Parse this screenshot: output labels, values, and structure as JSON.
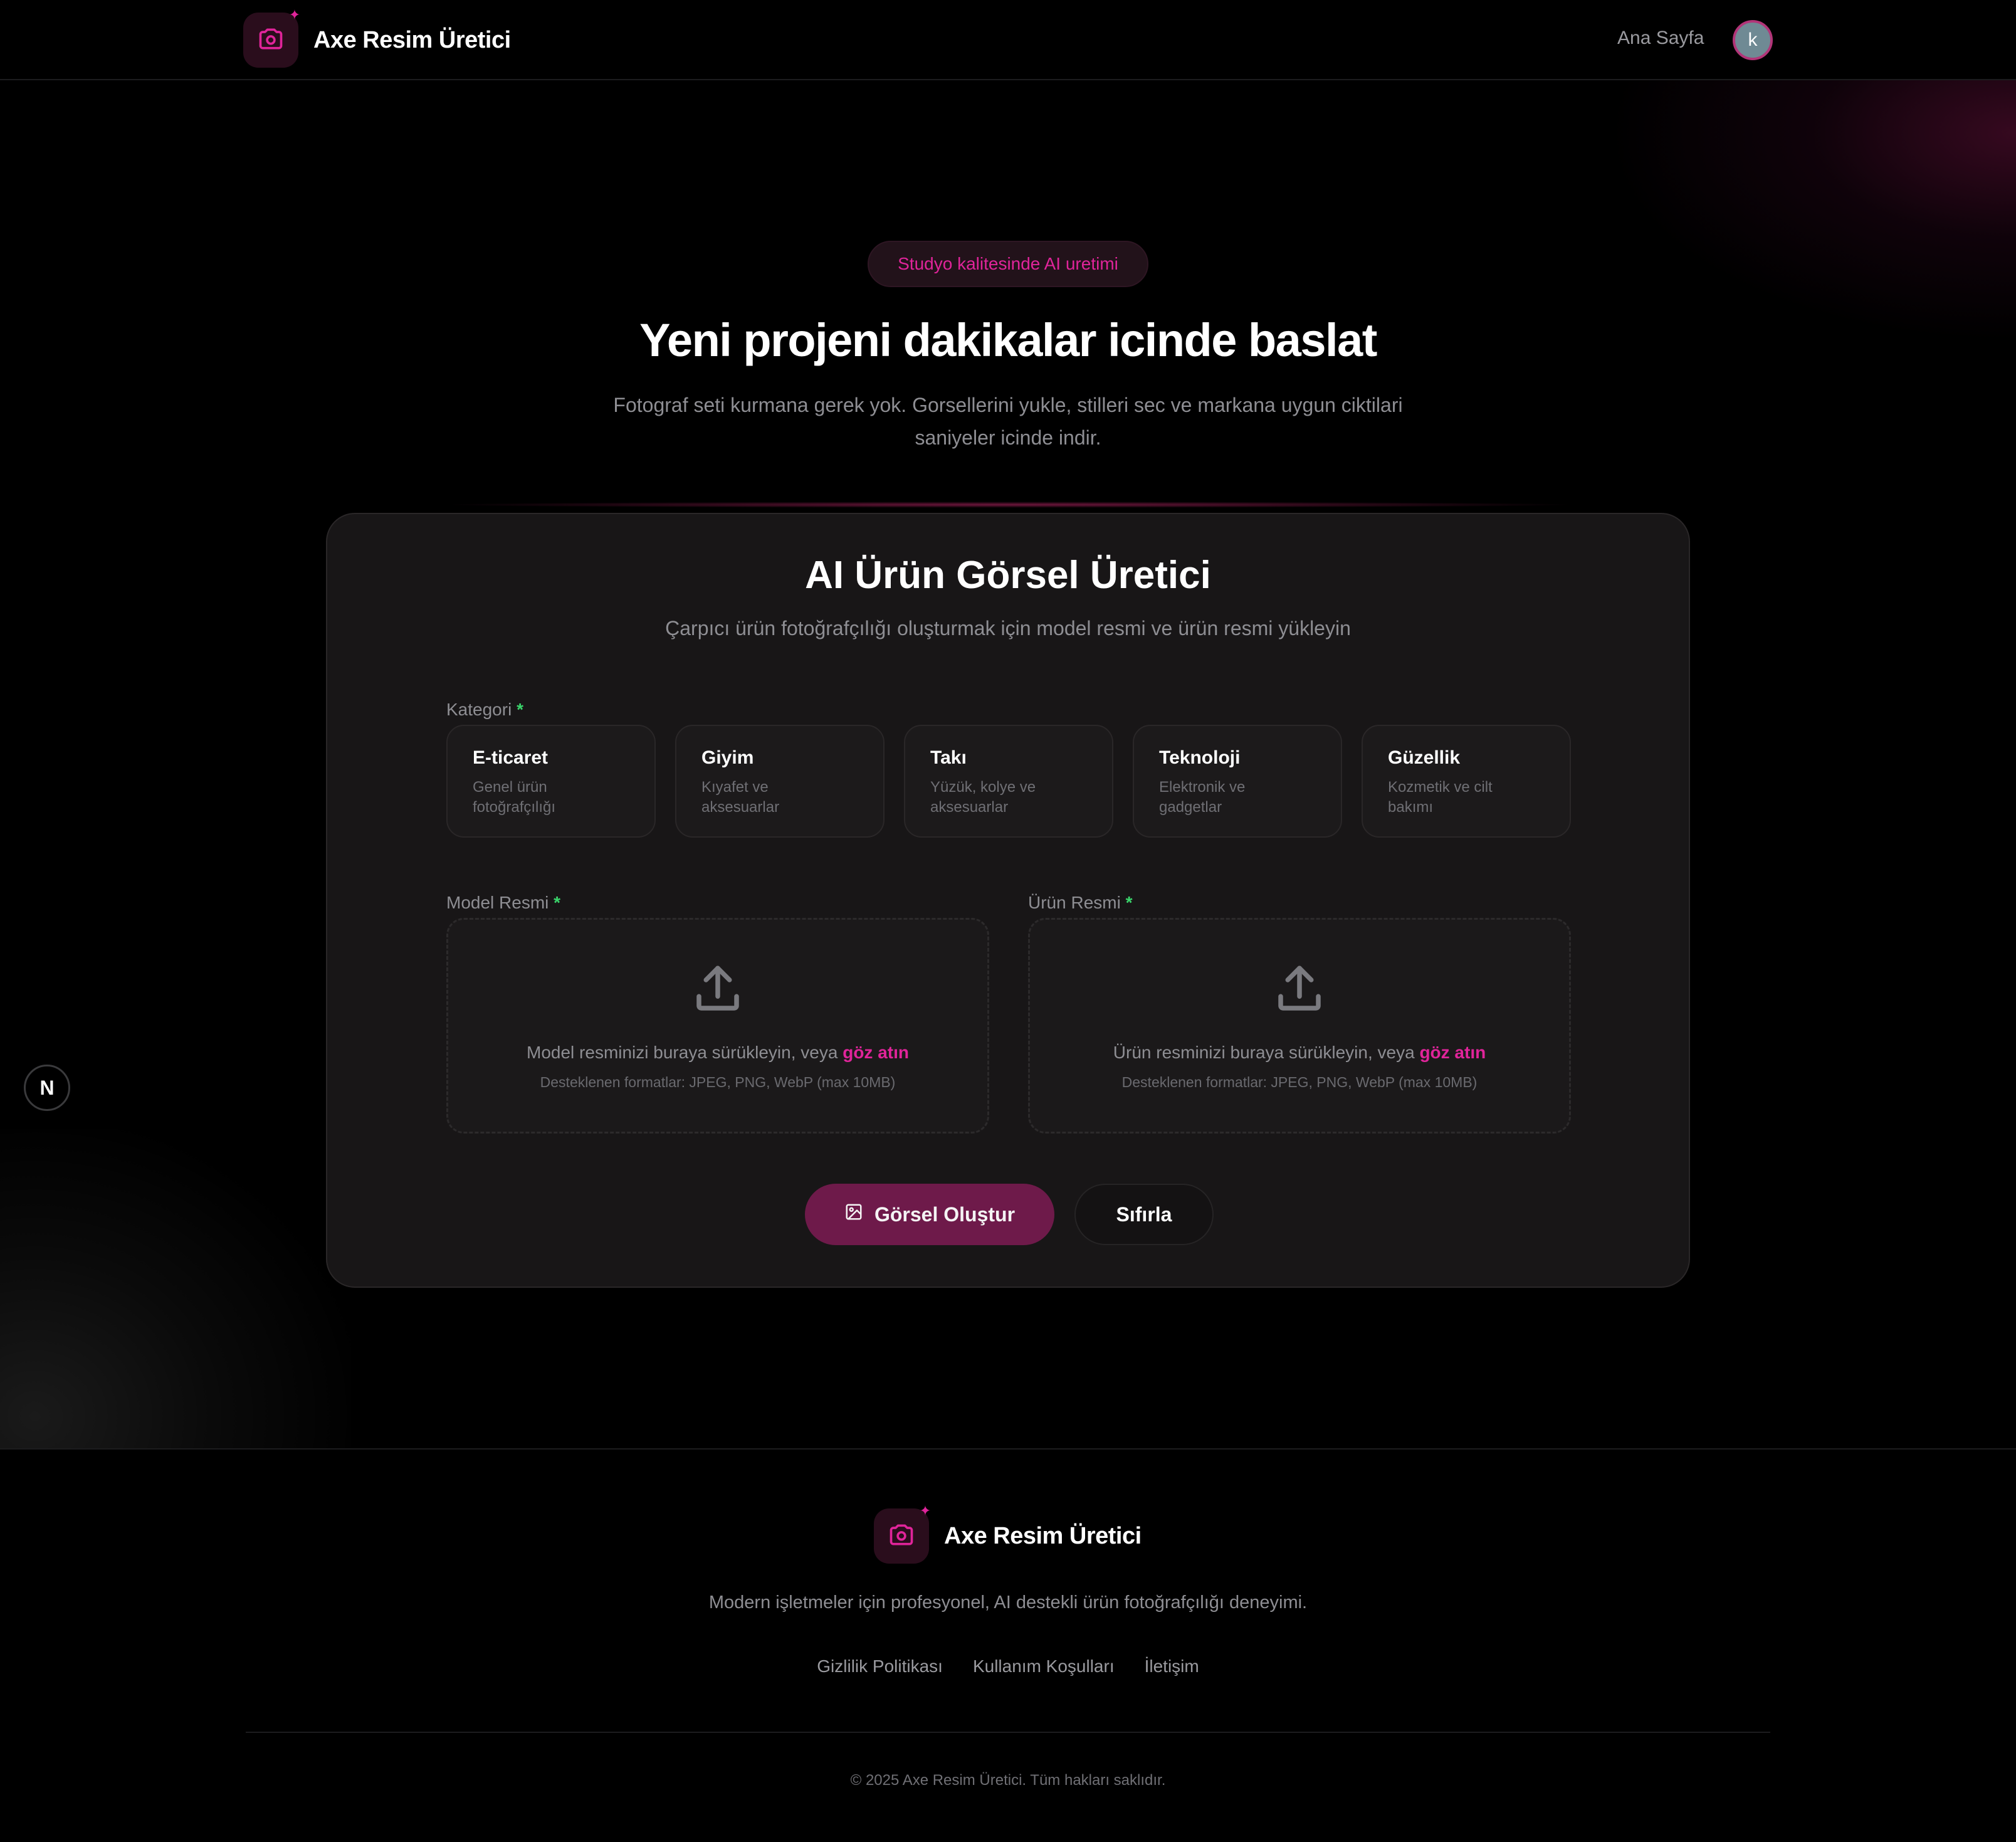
{
  "brand": {
    "name": "Axe Resim Üretici",
    "accent": "#e0249a",
    "logo_icon": "camera-icon"
  },
  "nav": {
    "home": "Ana Sayfa",
    "avatar_initial": "k"
  },
  "hero": {
    "badge": "Studyo kalitesinde AI uretimi",
    "title": "Yeni projeni dakikalar icinde baslat",
    "subtitle_line1": "Fotograf seti kurmana gerek yok. Gorsellerini yukle, stilleri sec ve markana uygun ciktilari",
    "subtitle_line2": "saniyeler icinde indir."
  },
  "card": {
    "title": "AI Ürün Görsel Üretici",
    "subtitle": "Çarpıcı ürün fotoğrafçılığı oluşturmak için model resmi ve ürün resmi yükleyin",
    "category_label": "Kategori",
    "required_mark": "*",
    "categories": [
      {
        "title": "E-ticaret",
        "desc": "Genel ürün fotoğrafçılığı"
      },
      {
        "title": "Giyim",
        "desc": "Kıyafet ve aksesuarlar"
      },
      {
        "title": "Takı",
        "desc": "Yüzük, kolye ve aksesuarlar"
      },
      {
        "title": "Teknoloji",
        "desc": "Elektronik ve gadgetlar"
      },
      {
        "title": "Güzellik",
        "desc": "Kozmetik ve cilt bakımı"
      }
    ],
    "model_upload": {
      "label": "Model Resmi",
      "text": "Model resminizi buraya sürükleyin, veya ",
      "link": "göz atın",
      "hint": "Desteklenen formatlar: JPEG, PNG, WebP (max 10MB)"
    },
    "product_upload": {
      "label": "Ürün Resmi",
      "text": "Ürün resminizi buraya sürükleyin, veya ",
      "link": "göz atın",
      "hint": "Desteklenen formatlar: JPEG, PNG, WebP (max 10MB)"
    },
    "generate_button": "Görsel Oluştur",
    "reset_button": "Sıfırla"
  },
  "floating": {
    "n_label": "N"
  },
  "footer": {
    "name": "Axe Resim Üretici",
    "description": "Modern işletmeler için profesyonel, AI destekli ürün fotoğrafçılığı deneyimi.",
    "links": [
      "Gizlilik Politikası",
      "Kullanım Koşulları",
      "İletişim"
    ],
    "copyright": "© 2025 Axe Resim Üretici. Tüm hakları saklıdır."
  }
}
